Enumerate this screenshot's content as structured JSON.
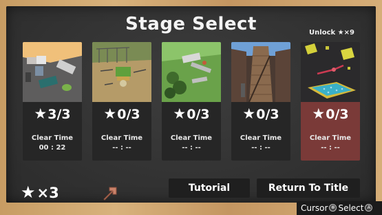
{
  "screen": {
    "title": "Stage Select",
    "unlock_label": "Unlock",
    "unlock_star": "★",
    "unlock_count": "×9"
  },
  "stages": [
    {
      "stars": "3/3",
      "clear_time_label": "Clear Time",
      "clear_time": "00 : 22",
      "locked": false
    },
    {
      "stars": "0/3",
      "clear_time_label": "Clear Time",
      "clear_time": "-- : --",
      "locked": false
    },
    {
      "stars": "0/3",
      "clear_time_label": "Clear Time",
      "clear_time": "-- : --",
      "locked": false
    },
    {
      "stars": "0/3",
      "clear_time_label": "Clear Time",
      "clear_time": "-- : --",
      "locked": false
    },
    {
      "stars": "0/3",
      "clear_time_label": "Clear Time",
      "clear_time": "-- : --",
      "locked": true
    }
  ],
  "star_glyph": "★",
  "total_stars": "×3",
  "buttons": {
    "tutorial": "Tutorial",
    "return_to_title": "Return To Title"
  },
  "controls_hint": {
    "cursor_label": "Cursor",
    "cursor_glyph": "⊕",
    "select_label": "Select",
    "select_glyph": "A"
  },
  "colors": {
    "board": "#333333",
    "frame_wood": "#c9a36e",
    "locked_card": "#7a3a38"
  }
}
